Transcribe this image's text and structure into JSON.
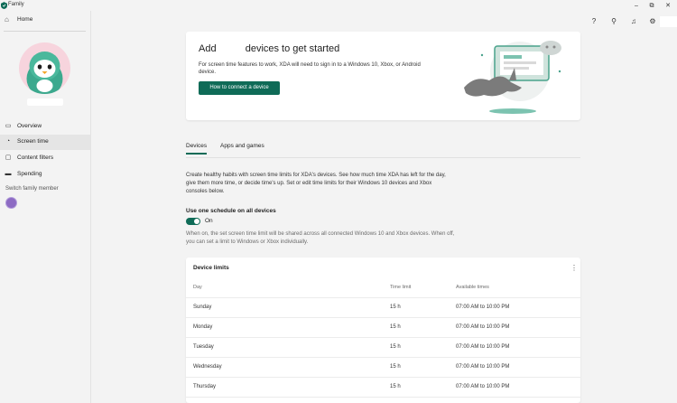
{
  "app": {
    "title": "Family"
  },
  "sidebar": {
    "home_label": "Home",
    "items": [
      {
        "label": "Overview",
        "icon": "overview-icon"
      },
      {
        "label": "Screen time",
        "icon": "screen-time-icon",
        "active": true
      },
      {
        "label": "Content filters",
        "icon": "content-filters-icon"
      },
      {
        "label": "Spending",
        "icon": "spending-icon"
      }
    ],
    "switch_label": "Switch family member"
  },
  "banner": {
    "title_part1": "Add",
    "title_part2": "devices to get started",
    "description": "For screen time features to work, XDA will need to sign in to a Windows 10, Xbox, or Android device.",
    "button_label": "How to connect a device"
  },
  "tabs": [
    {
      "label": "Devices",
      "active": true
    },
    {
      "label": "Apps and games",
      "active": false
    }
  ],
  "intro": "Create healthy habits with screen time limits for XDA's devices. See how much time XDA has left for the day, give them more time, or decide time's up. Set or edit time limits for their Windows 10 devices and Xbox consoles below.",
  "schedule": {
    "label": "Use one schedule on all devices",
    "state": "On",
    "note": "When on, the set screen time limit will be shared across all connected Windows 10 and Xbox devices. When off, you can set a limit to Windows or Xbox individually."
  },
  "limits": {
    "title": "Device limits",
    "columns": [
      "Day",
      "Time limit",
      "Available times"
    ],
    "rows": [
      {
        "day": "Sunday",
        "limit": "15 h",
        "times": "07:00 AM to 10:00 PM"
      },
      {
        "day": "Monday",
        "limit": "15 h",
        "times": "07:00 AM to 10:00 PM"
      },
      {
        "day": "Tuesday",
        "limit": "15 h",
        "times": "07:00 AM to 10:00 PM"
      },
      {
        "day": "Wednesday",
        "limit": "15 h",
        "times": "07:00 AM to 10:00 PM"
      },
      {
        "day": "Thursday",
        "limit": "15 h",
        "times": "07:00 AM to 10:00 PM"
      }
    ]
  },
  "colors": {
    "accent": "#0f6b57",
    "active_nav": "#e5e5e5",
    "avatar_bg": "#f7d4dd"
  }
}
